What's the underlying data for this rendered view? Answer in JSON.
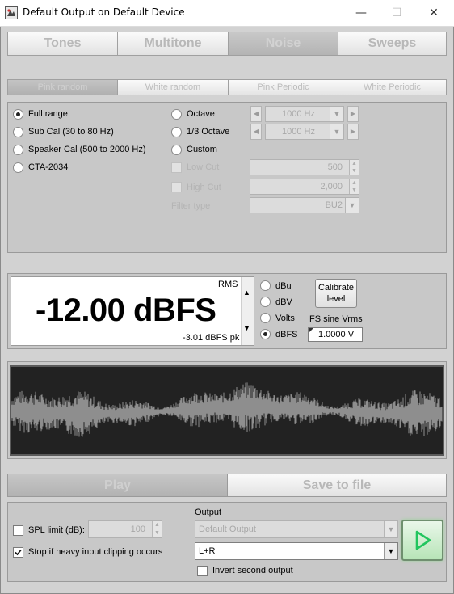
{
  "window": {
    "title": "Default Output on Default Device",
    "minimize_glyph": "—",
    "maximize_glyph": "☐",
    "close_glyph": "✕"
  },
  "main_tabs": [
    {
      "label": "Tones",
      "selected": false
    },
    {
      "label": "Multitone",
      "selected": false
    },
    {
      "label": "Noise",
      "selected": true
    },
    {
      "label": "Sweeps",
      "selected": false
    }
  ],
  "noise_tabs": [
    {
      "label": "Pink random",
      "selected": true
    },
    {
      "label": "White random",
      "selected": false
    },
    {
      "label": "Pink Periodic",
      "selected": false
    },
    {
      "label": "White Periodic",
      "selected": false
    }
  ],
  "range": {
    "options": [
      {
        "label": "Full range",
        "selected": true
      },
      {
        "label": "Sub Cal (30 to 80 Hz)",
        "selected": false
      },
      {
        "label": "Speaker Cal (500 to 2000 Hz)",
        "selected": false
      },
      {
        "label": "CTA-2034",
        "selected": false
      }
    ],
    "band_options": [
      {
        "label": "Octave",
        "value": "1000 Hz"
      },
      {
        "label": "1/3 Octave",
        "value": "1000 Hz"
      },
      {
        "label": "Custom"
      }
    ],
    "low_cut": {
      "label": "Low Cut",
      "value": "500"
    },
    "high_cut": {
      "label": "High Cut",
      "value": "2,000"
    },
    "filter_type": {
      "label": "Filter type",
      "value": "BU2"
    }
  },
  "level": {
    "rms_label": "RMS",
    "value": "-12.00 dBFS",
    "peak": "-3.01 dBFS pk",
    "units": [
      {
        "label": "dBu",
        "selected": false
      },
      {
        "label": "dBV",
        "selected": false
      },
      {
        "label": "Volts",
        "selected": false
      },
      {
        "label": "dBFS",
        "selected": true
      }
    ],
    "calibrate_label": "Calibrate level",
    "fs_label": "FS sine Vrms",
    "fs_value": "1.0000 V"
  },
  "actions": {
    "play_label": "Play",
    "save_label": "Save to file"
  },
  "bottom": {
    "spl_label": "SPL limit (dB):",
    "spl_value": "100",
    "spl_checked": false,
    "clip_label": "Stop if heavy input clipping occurs",
    "clip_checked": true,
    "output_label": "Output",
    "output_device": "Default Output",
    "channel": "L+R",
    "invert_label": "Invert second output",
    "invert_checked": false,
    "play_icon": "play-triangle-icon"
  },
  "colors": {
    "waveform": "#8e8e8e",
    "play_green": "#22c55e"
  }
}
